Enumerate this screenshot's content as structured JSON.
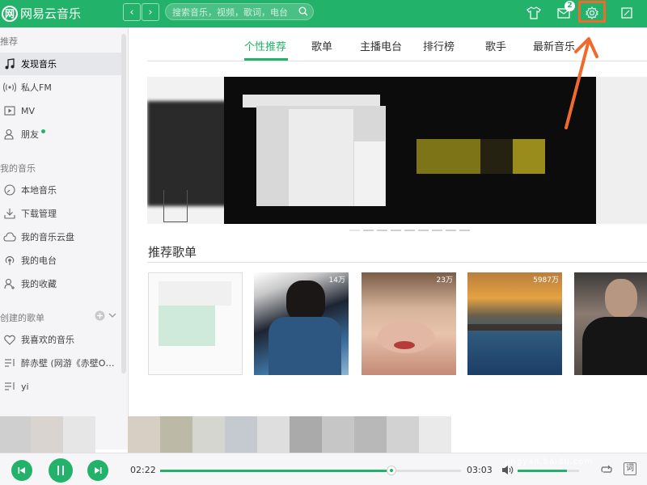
{
  "app": {
    "name": "网易云音乐",
    "logo_glyph": "网"
  },
  "titlebar": {
    "back_glyph": "‹",
    "forward_glyph": "›",
    "search_placeholder": "搜索音乐，视频，歌词，电台",
    "mail_badge": "2",
    "icons": [
      "skin-icon",
      "mail-icon",
      "gear-icon",
      "mini-mode-icon"
    ]
  },
  "sidebar": {
    "sections": [
      {
        "title": "推荐",
        "items": [
          {
            "label": "发现音乐",
            "icon": "music-note-icon",
            "active": true
          },
          {
            "label": "私人FM",
            "icon": "radio-wave-icon"
          },
          {
            "label": "MV",
            "icon": "video-icon"
          },
          {
            "label": "朋友",
            "icon": "friends-icon",
            "dot": true
          }
        ]
      },
      {
        "title": "我的音乐",
        "items": [
          {
            "label": "本地音乐",
            "icon": "disc-icon"
          },
          {
            "label": "下载管理",
            "icon": "download-icon"
          },
          {
            "label": "我的音乐云盘",
            "icon": "cloud-icon"
          },
          {
            "label": "我的电台",
            "icon": "podcast-icon"
          },
          {
            "label": "我的收藏",
            "icon": "collect-icon"
          }
        ]
      },
      {
        "title": "创建的歌单",
        "items": [
          {
            "label": "我喜欢的音乐",
            "icon": "heart-icon"
          },
          {
            "label": "醉赤壁 (网游《赤壁Online》主题曲)",
            "icon": "playlist-icon"
          },
          {
            "label": "yi",
            "icon": "playlist-icon"
          }
        ]
      }
    ]
  },
  "tabs": [
    {
      "label": "个性推荐",
      "active": true
    },
    {
      "label": "歌单"
    },
    {
      "label": "主播电台"
    },
    {
      "label": "排行榜"
    },
    {
      "label": "歌手"
    },
    {
      "label": "最新音乐"
    }
  ],
  "section": {
    "recommended_playlists": "推荐歌单"
  },
  "playlist_cards": [
    {
      "count": ""
    },
    {
      "count": "14万"
    },
    {
      "count": "23万"
    },
    {
      "count": "5987万"
    },
    {
      "count": ""
    }
  ],
  "player": {
    "current_time": "02:22",
    "total_time": "03:03",
    "progress": 0.77,
    "volume": 0.8,
    "lyrics_label": "词"
  },
  "watermark": {
    "brand": "Bai",
    "brand_suffix": "du",
    "suffix": "经验",
    "url": "jingyan.baidu.com"
  },
  "colors": {
    "accent": "#23b26a",
    "highlight": "#f06a2e"
  }
}
